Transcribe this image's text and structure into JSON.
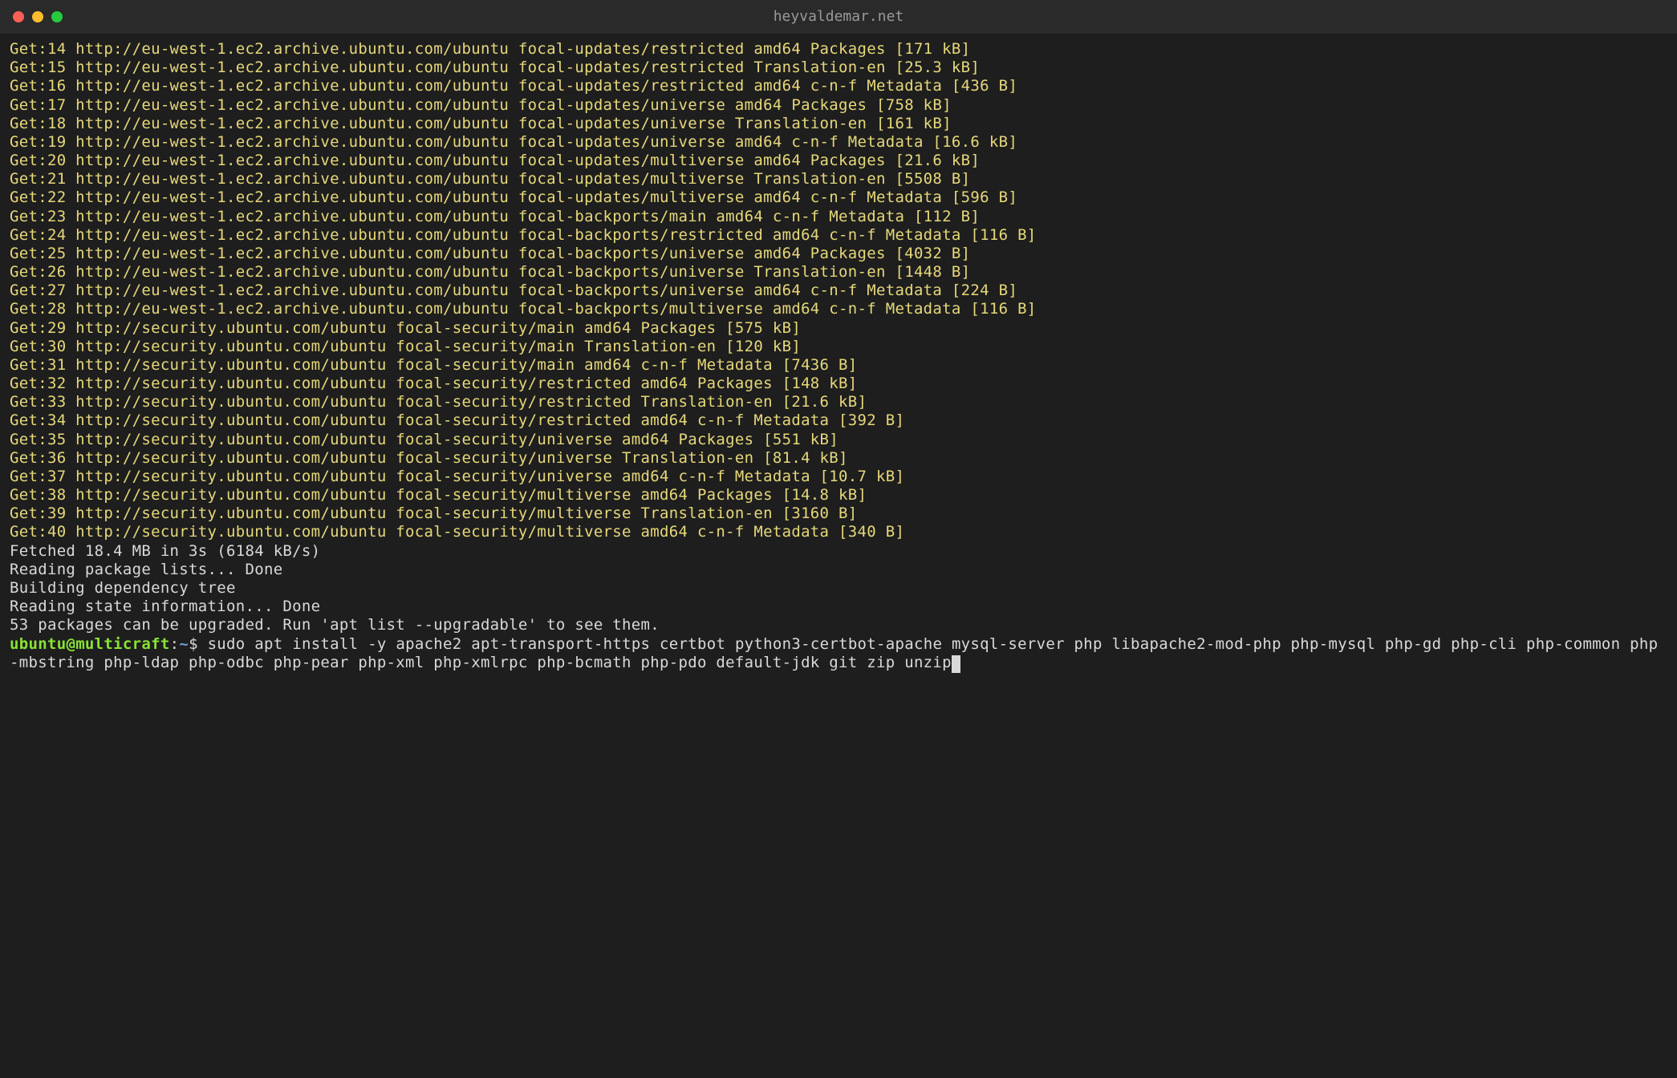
{
  "window": {
    "title": "heyvaldemar.net"
  },
  "colors": {
    "bg": "#1e1e1e",
    "titlebar": "#2a2a2a",
    "text_output": "#e6d87a",
    "text_status": "#d9d9d9",
    "prompt_user": "#8ae234",
    "prompt_path": "#729fcf"
  },
  "output_lines": [
    "Get:14 http://eu-west-1.ec2.archive.ubuntu.com/ubuntu focal-updates/restricted amd64 Packages [171 kB]",
    "Get:15 http://eu-west-1.ec2.archive.ubuntu.com/ubuntu focal-updates/restricted Translation-en [25.3 kB]",
    "Get:16 http://eu-west-1.ec2.archive.ubuntu.com/ubuntu focal-updates/restricted amd64 c-n-f Metadata [436 B]",
    "Get:17 http://eu-west-1.ec2.archive.ubuntu.com/ubuntu focal-updates/universe amd64 Packages [758 kB]",
    "Get:18 http://eu-west-1.ec2.archive.ubuntu.com/ubuntu focal-updates/universe Translation-en [161 kB]",
    "Get:19 http://eu-west-1.ec2.archive.ubuntu.com/ubuntu focal-updates/universe amd64 c-n-f Metadata [16.6 kB]",
    "Get:20 http://eu-west-1.ec2.archive.ubuntu.com/ubuntu focal-updates/multiverse amd64 Packages [21.6 kB]",
    "Get:21 http://eu-west-1.ec2.archive.ubuntu.com/ubuntu focal-updates/multiverse Translation-en [5508 B]",
    "Get:22 http://eu-west-1.ec2.archive.ubuntu.com/ubuntu focal-updates/multiverse amd64 c-n-f Metadata [596 B]",
    "Get:23 http://eu-west-1.ec2.archive.ubuntu.com/ubuntu focal-backports/main amd64 c-n-f Metadata [112 B]",
    "Get:24 http://eu-west-1.ec2.archive.ubuntu.com/ubuntu focal-backports/restricted amd64 c-n-f Metadata [116 B]",
    "Get:25 http://eu-west-1.ec2.archive.ubuntu.com/ubuntu focal-backports/universe amd64 Packages [4032 B]",
    "Get:26 http://eu-west-1.ec2.archive.ubuntu.com/ubuntu focal-backports/universe Translation-en [1448 B]",
    "Get:27 http://eu-west-1.ec2.archive.ubuntu.com/ubuntu focal-backports/universe amd64 c-n-f Metadata [224 B]",
    "Get:28 http://eu-west-1.ec2.archive.ubuntu.com/ubuntu focal-backports/multiverse amd64 c-n-f Metadata [116 B]",
    "Get:29 http://security.ubuntu.com/ubuntu focal-security/main amd64 Packages [575 kB]",
    "Get:30 http://security.ubuntu.com/ubuntu focal-security/main Translation-en [120 kB]",
    "Get:31 http://security.ubuntu.com/ubuntu focal-security/main amd64 c-n-f Metadata [7436 B]",
    "Get:32 http://security.ubuntu.com/ubuntu focal-security/restricted amd64 Packages [148 kB]",
    "Get:33 http://security.ubuntu.com/ubuntu focal-security/restricted Translation-en [21.6 kB]",
    "Get:34 http://security.ubuntu.com/ubuntu focal-security/restricted amd64 c-n-f Metadata [392 B]",
    "Get:35 http://security.ubuntu.com/ubuntu focal-security/universe amd64 Packages [551 kB]",
    "Get:36 http://security.ubuntu.com/ubuntu focal-security/universe Translation-en [81.4 kB]",
    "Get:37 http://security.ubuntu.com/ubuntu focal-security/universe amd64 c-n-f Metadata [10.7 kB]",
    "Get:38 http://security.ubuntu.com/ubuntu focal-security/multiverse amd64 Packages [14.8 kB]",
    "Get:39 http://security.ubuntu.com/ubuntu focal-security/multiverse Translation-en [3160 B]",
    "Get:40 http://security.ubuntu.com/ubuntu focal-security/multiverse amd64 c-n-f Metadata [340 B]"
  ],
  "status_lines": [
    "Fetched 18.4 MB in 3s (6184 kB/s)",
    "Reading package lists... Done",
    "Building dependency tree",
    "Reading state information... Done",
    "53 packages can be upgraded. Run 'apt list --upgradable' to see them."
  ],
  "prompt": {
    "user": "ubuntu",
    "at": "@",
    "host": "multicraft",
    "colon": ":",
    "path": "~",
    "dollar": "$",
    "command": " sudo apt install -y apache2 apt-transport-https certbot python3-certbot-apache mysql-server php libapache2-mod-php php-mysql php-gd php-cli php-common php-mbstring php-ldap php-odbc php-pear php-xml php-xmlrpc php-bcmath php-pdo default-jdk git zip unzip"
  }
}
